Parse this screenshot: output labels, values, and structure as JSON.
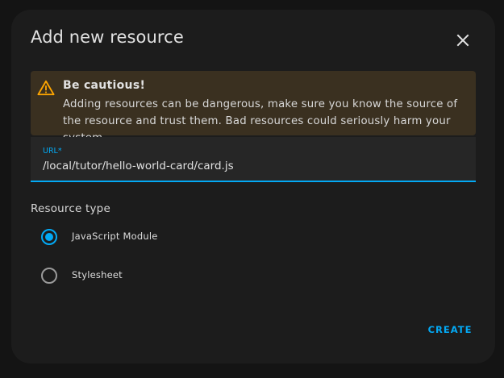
{
  "dialog": {
    "title": "Add new resource",
    "close_icon": "close-icon"
  },
  "alert": {
    "icon": "warning-icon",
    "title": "Be cautious!",
    "text": "Adding resources can be dangerous, make sure you know the source of the resource and trust them. Bad resources could seriously harm your system."
  },
  "url_field": {
    "label": "URL*",
    "value": "/local/tutor/hello-world-card/card.js"
  },
  "resource_type": {
    "label": "Resource type",
    "options": [
      {
        "label": "JavaScript Module",
        "checked": true
      },
      {
        "label": "Stylesheet",
        "checked": false
      }
    ]
  },
  "actions": {
    "create_label": "CREATE"
  },
  "colors": {
    "accent": "#03a9f4",
    "dialog_bg": "#1c1c1c",
    "warning_bg": "#3a3020",
    "warning_icon": "#ffa600"
  }
}
